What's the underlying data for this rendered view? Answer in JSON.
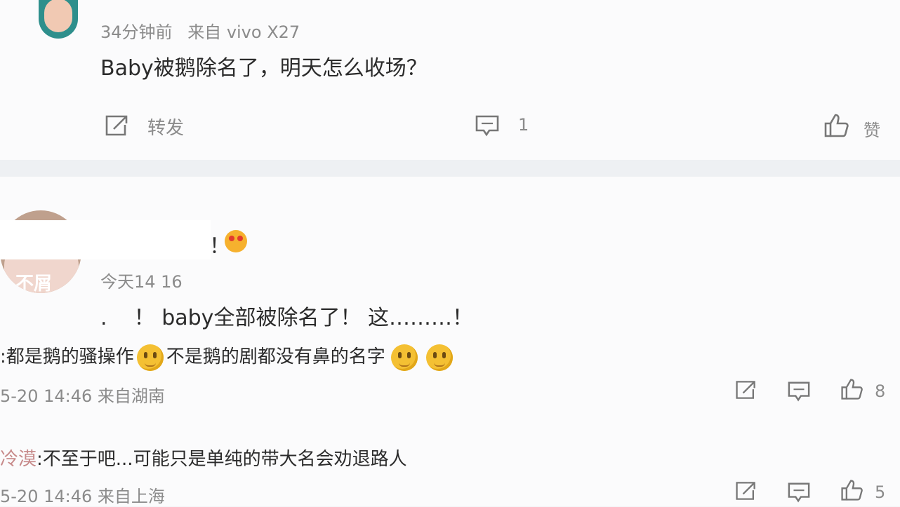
{
  "comment1": {
    "time": "34分钟前",
    "source": "来自 vivo X27",
    "text": "Baby被鹅除名了，明天怎么收场？",
    "forward_label": "转发",
    "comment_count": "1",
    "like_label": "赞"
  },
  "comment2": {
    "name_suffix": "！",
    "avatar_text": "不屑",
    "time": "今天14 16",
    "text": ".    ！ baby全部被除名了！ 这………！",
    "replies": [
      {
        "text_a": ":都是鹅的骚操作",
        "text_b": "不是鹅的剧都没有鼻的名字",
        "meta": "5-20 14:46 来自湖南",
        "like_count": "8"
      },
      {
        "name_frag": "冷漠",
        "text": ":不至于吧...可能只是单纯的带大名会劝退路人",
        "meta": "5-20 14:46 来自上海",
        "like_count": "5"
      }
    ]
  },
  "icons": {
    "emoji_name": "smile-emoji",
    "forward": "share-icon",
    "comment": "comment-icon",
    "like": "thumbs-up-icon"
  },
  "colors": {
    "background": "#fbfbfc",
    "text": "#2b2b2b",
    "meta": "#8b8b8b"
  }
}
